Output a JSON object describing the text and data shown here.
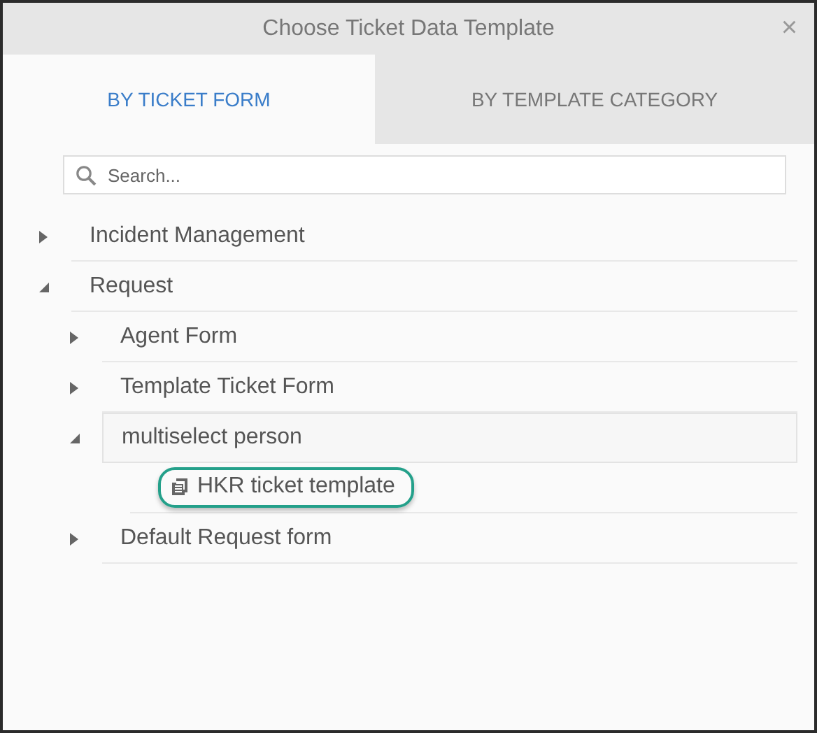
{
  "window": {
    "title": "Choose Ticket Data Template",
    "close": "×"
  },
  "tabs": [
    {
      "label": "BY TICKET FORM",
      "selected": true
    },
    {
      "label": "BY TEMPLATE CATEGORY",
      "selected": false
    }
  ],
  "search": {
    "placeholder": "Search..."
  },
  "tree": [
    {
      "kind": "folder",
      "label": "Incident Management",
      "expanded": false,
      "selected": false
    },
    {
      "kind": "folder",
      "label": "Request",
      "expanded": true,
      "selected": false,
      "children": [
        {
          "kind": "folder",
          "label": "Agent Form",
          "expanded": false,
          "selected": false
        },
        {
          "kind": "folder",
          "label": "Template Ticket Form",
          "expanded": false,
          "selected": false
        },
        {
          "kind": "folder",
          "label": "multiselect person",
          "expanded": true,
          "selected": true,
          "children": [
            {
              "kind": "template",
              "label": "HKR ticket template",
              "selected": false,
              "highlighted": true
            }
          ]
        },
        {
          "kind": "folder",
          "label": "Default Request form",
          "expanded": false,
          "selected": false
        }
      ]
    }
  ]
}
